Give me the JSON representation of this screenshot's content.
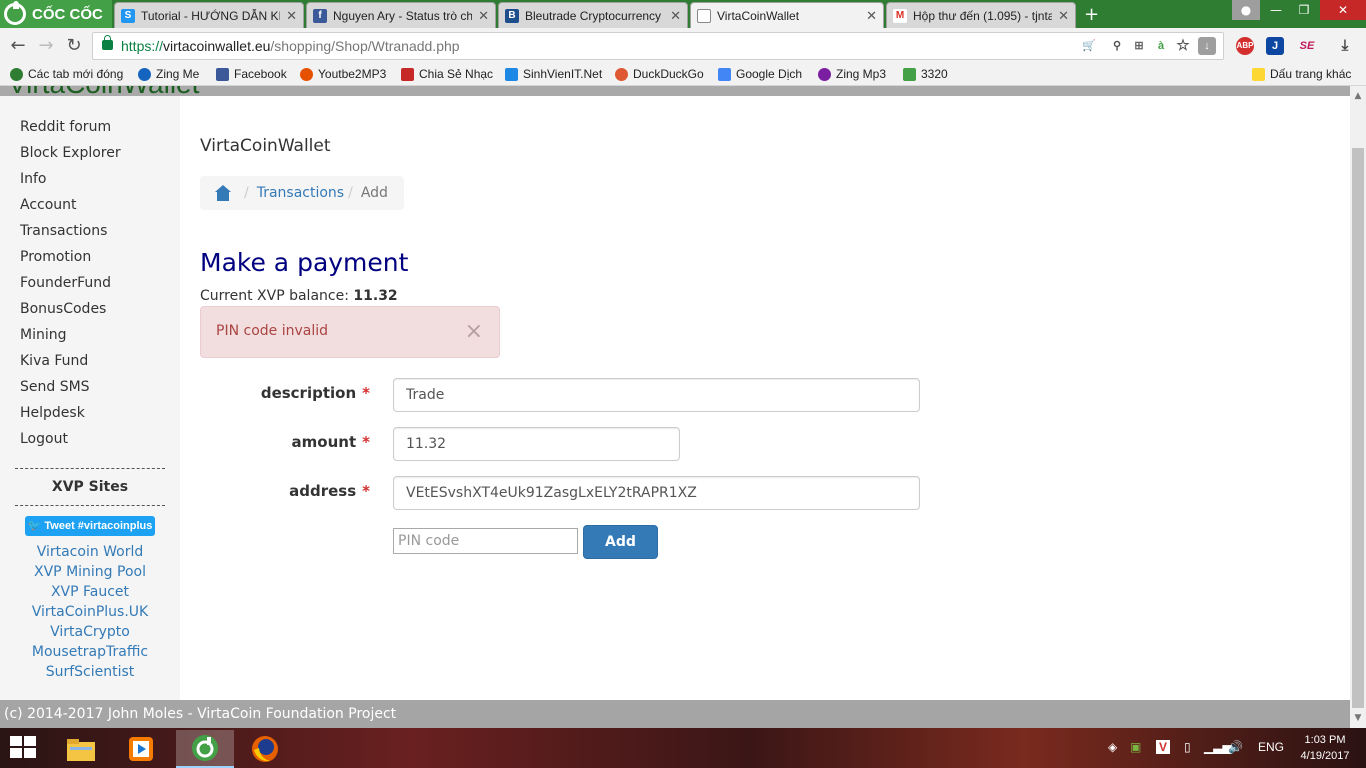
{
  "browser": {
    "brand": "CỐC CỐC",
    "tabs": [
      {
        "label": "Tutorial - HƯỚNG DẪN KI",
        "favicon_color": "#2196f3",
        "favicon_glyph": "S"
      },
      {
        "label": "Nguyen Ary - Status trò ch",
        "favicon_color": "#3b5998",
        "favicon_glyph": "f"
      },
      {
        "label": "Bleutrade Cryptocurrency E",
        "favicon_color": "#1e4e8c",
        "favicon_glyph": "B"
      },
      {
        "label": "VirtaCoinWallet",
        "favicon_color": "#ffffff",
        "favicon_glyph": ""
      },
      {
        "label": "Hộp thư đến (1.095) - tjnta",
        "favicon_color": "#ffffff",
        "favicon_glyph": "M"
      }
    ],
    "url": {
      "scheme": "https://",
      "host": "virtacoinwallet.eu",
      "path": "/shopping/Shop/Wtranadd.php"
    },
    "bookmarks": [
      {
        "label": "Các tab mới đóng",
        "color": "#2e7d32"
      },
      {
        "label": "Zing Me",
        "color": "#1565c0"
      },
      {
        "label": "Facebook",
        "color": "#3b5998"
      },
      {
        "label": "Youtbe2MP3",
        "color": "#e65100"
      },
      {
        "label": "Chia Sẻ Nhạc",
        "color": "#c62828"
      },
      {
        "label": "SinhVienIT.Net",
        "color": "#1e88e5"
      },
      {
        "label": "DuckDuckGo",
        "color": "#de5833"
      },
      {
        "label": "Google Dịch",
        "color": "#4285f4"
      },
      {
        "label": "Zing Mp3",
        "color": "#7b1fa2"
      },
      {
        "label": "3320",
        "color": "#43a047"
      }
    ],
    "bookmarks_other": "Dấu trang khác"
  },
  "sidebar": {
    "nav": [
      "Reddit forum",
      "Block Explorer",
      "Info",
      "Account",
      "Transactions",
      "Promotion",
      "FounderFund",
      "BonusCodes",
      "Mining",
      "Kiva Fund",
      "Send SMS",
      "Helpdesk",
      "Logout"
    ],
    "sites_title": "XVP Sites",
    "tweet_label": "Tweet #virtacoinplus",
    "sites": [
      "Virtacoin World",
      "XVP Mining Pool",
      "XVP Faucet",
      "VirtaCoinPlus.UK",
      "VirtaCrypto",
      "MousetrapTraffic",
      "SurfScientist"
    ]
  },
  "main": {
    "app_title": "VirtaCoinWallet",
    "breadcrumb": {
      "link": "Transactions",
      "current": "Add"
    },
    "heading": "Make a payment",
    "balance_label": "Current XVP balance:",
    "balance_value": "11.32",
    "alert": "PIN code invalid",
    "alert_close": "×",
    "form": {
      "description": {
        "label": "description",
        "value": "Trade"
      },
      "amount": {
        "label": "amount",
        "value": "11.32"
      },
      "address": {
        "label": "address",
        "value": "VEtESvshXT4eUk91ZasgLxELY2tRAPR1XZ"
      },
      "required_mark": "*",
      "pin_placeholder": "PIN code",
      "submit": "Add"
    }
  },
  "footer": "(c) 2014-2017 John Moles - VirtaCoin Foundation Project",
  "taskbar": {
    "language": "ENG",
    "time": "1:03 PM",
    "date": "4/19/2017"
  },
  "colors": {
    "accent": "#337ab7",
    "heading": "#000080",
    "alert_bg": "#f2dede",
    "alert_text": "#a94442"
  }
}
